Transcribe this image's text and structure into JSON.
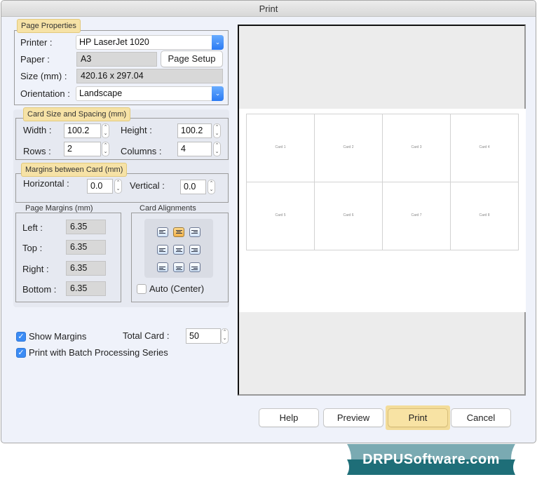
{
  "window": {
    "title": "Print"
  },
  "page_properties": {
    "legend": "Page Properties",
    "printer_label": "Printer :",
    "printer_value": "HP LaserJet 1020",
    "paper_label": "Paper :",
    "paper_value": "A3",
    "page_setup_button": "Page Setup",
    "size_label": "Size (mm) :",
    "size_value": "420.16 x 297.04",
    "orientation_label": "Orientation :",
    "orientation_value": "Landscape"
  },
  "card_size": {
    "legend": "Card Size and Spacing (mm)",
    "width_label": "Width :",
    "width_value": "100.2",
    "height_label": "Height :",
    "height_value": "100.2",
    "rows_label": "Rows :",
    "rows_value": "2",
    "columns_label": "Columns :",
    "columns_value": "4"
  },
  "margins_between": {
    "legend": "Margins between Card (mm)",
    "horizontal_label": "Horizontal :",
    "horizontal_value": "0.0",
    "vertical_label": "Vertical :",
    "vertical_value": "0.0"
  },
  "page_margins": {
    "legend": "Page Margins (mm)",
    "left_label": "Left :",
    "left_value": "6.35",
    "top_label": "Top :",
    "top_value": "6.35",
    "right_label": "Right :",
    "right_value": "6.35",
    "bottom_label": "Bottom :",
    "bottom_value": "6.35"
  },
  "card_alignments": {
    "legend": "Card Alignments",
    "selected": "top-center",
    "options": [
      "top-left",
      "top-center",
      "top-right",
      "middle-left",
      "middle-center",
      "middle-right",
      "bottom-left",
      "bottom-center",
      "bottom-right"
    ],
    "auto_center_label": "Auto (Center)",
    "auto_center_checked": false
  },
  "options": {
    "show_margins_label": "Show Margins",
    "show_margins_checked": true,
    "batch_label": "Print with Batch Processing Series",
    "batch_checked": true,
    "total_card_label": "Total Card :",
    "total_card_value": "50"
  },
  "preview": {
    "cards": [
      "Card 1",
      "Card 2",
      "Card 3",
      "Card 4",
      "Card 5",
      "Card 6",
      "Card 7",
      "Card 8"
    ]
  },
  "buttons": {
    "help": "Help",
    "preview": "Preview",
    "print": "Print",
    "cancel": "Cancel"
  },
  "brand": {
    "text": "DRPUSoftware.com"
  },
  "colors": {
    "accent_blue": "#2b7af3",
    "highlight_yellow": "#f6e2a6",
    "brand_teal": "#1e6e78"
  }
}
